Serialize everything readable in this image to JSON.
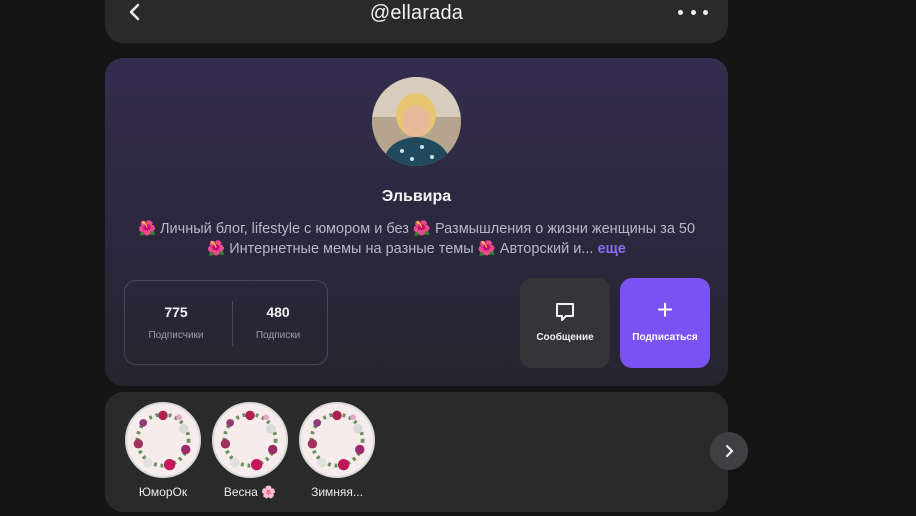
{
  "header": {
    "title": "@ellarada",
    "back_icon": "chevron-left-icon",
    "more_icon": "more-horizontal-icon"
  },
  "profile": {
    "name": "Эльвира",
    "bio_line1": "🌺 Личный блог, lifestyle с юмором и без 🌺 Размышления о жизни женщины за 50",
    "bio_line2": "🌺 Интернетные мемы на разные темы 🌺 Авторский и...",
    "bio_more": "еще",
    "stats": [
      {
        "value": "775",
        "label": "Подписчики"
      },
      {
        "value": "480",
        "label": "Подписки"
      }
    ],
    "message_button": {
      "label": "Сообщение",
      "icon": "chat-icon"
    },
    "subscribe_button": {
      "label": "Подписаться",
      "icon": "plus-icon",
      "color": "#7b52f2"
    }
  },
  "highlights": {
    "items": [
      {
        "label": "ЮморОк"
      },
      {
        "label": "Весна 🌸"
      },
      {
        "label": "Зимняя..."
      }
    ],
    "next_icon": "chevron-right-icon"
  },
  "colors": {
    "background": "#151515",
    "accent": "#7b52f2",
    "link": "#8b6cf7"
  }
}
